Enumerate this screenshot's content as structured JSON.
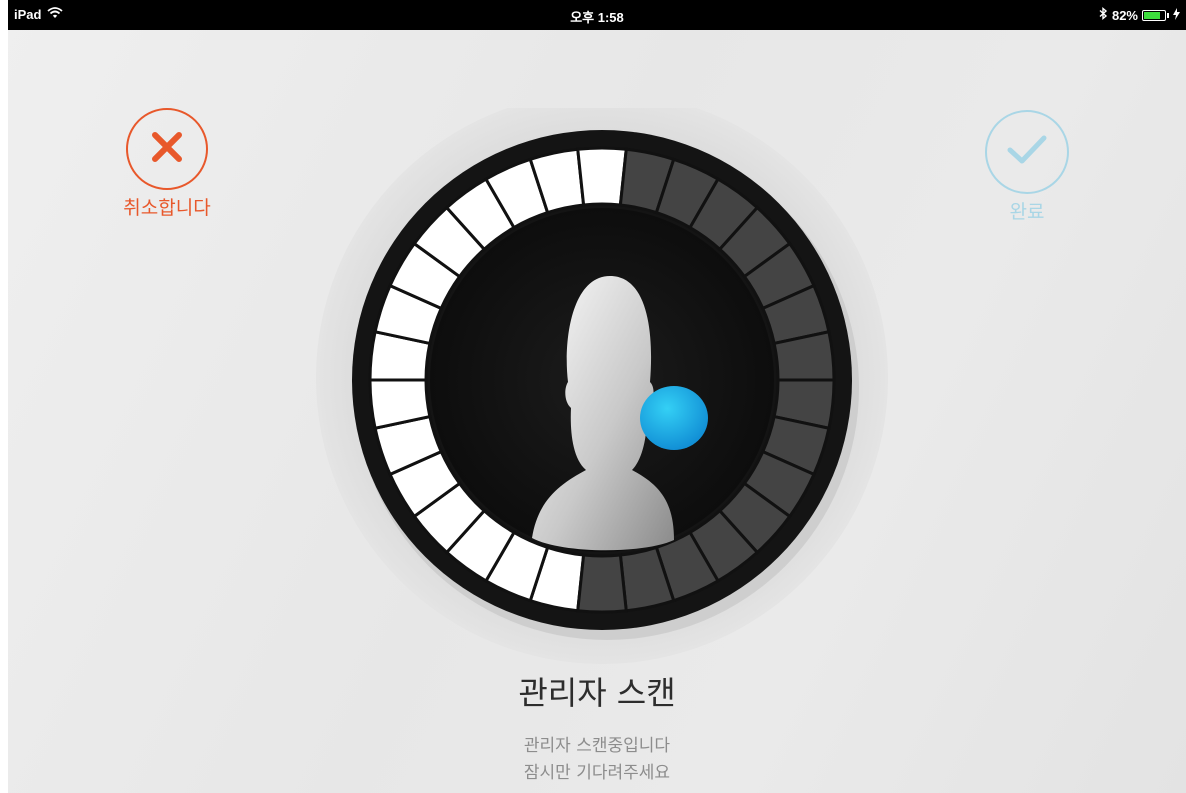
{
  "status_bar": {
    "device": "iPad",
    "time": "오후 1:58",
    "battery_text": "82%",
    "battery_level": 0.82
  },
  "actions": {
    "cancel_label": "취소합니다",
    "done_label": "완료"
  },
  "scan": {
    "progress_segments_filled": 15,
    "total_segments": 30,
    "title": "관리자 스캔",
    "status_line1": "관리자 스캔중입니다",
    "status_line2": "잠시만 기다려주세요"
  },
  "icons": {
    "cancel": "close-icon",
    "done": "checkmark-icon",
    "wifi": "wifi-icon",
    "bluetooth": "bluetooth-icon",
    "battery": "battery-icon",
    "charging": "charging-bolt-icon",
    "user": "user-silhouette-icon",
    "scan_dot": "scan-indicator-dot"
  },
  "colors": {
    "cancel_accent": "#e8582b",
    "done_accent": "#a9d6e6",
    "progress_filled": "#ffffff",
    "progress_empty": "#444444",
    "indicator": "#1ea8e0"
  }
}
